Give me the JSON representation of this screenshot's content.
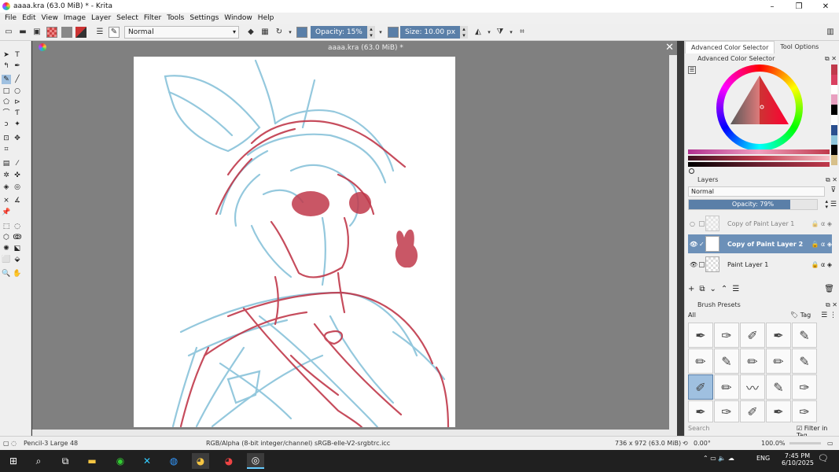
{
  "window": {
    "title": "aaaa.kra (63.0 MiB) * - Krita",
    "minimize": "–",
    "maximize": "❐",
    "close": "✕"
  },
  "menu": [
    "File",
    "Edit",
    "View",
    "Image",
    "Layer",
    "Select",
    "Filter",
    "Tools",
    "Settings",
    "Window",
    "Help"
  ],
  "toolbar": {
    "blend_mode": "Normal",
    "opacity_label": "Opacity: 15%",
    "size_label": "Size: 10.00 px"
  },
  "document": {
    "tab_title": "aaaa.kra (63.0 MiB) *",
    "close": "✕"
  },
  "right_dock": {
    "tabs": [
      "Advanced Color Selector",
      "Tool Options"
    ],
    "color_panel_title": "Advanced Color Selector",
    "layers_title": "Layers",
    "layers_blend": "Normal",
    "layers_opacity": "Opacity:  79%",
    "layers_opacity_value": 0.79,
    "layers": [
      {
        "name": "Copy of Paint Layer 1"
      },
      {
        "name": "Copy of Paint Layer 2"
      },
      {
        "name": "Paint Layer 1"
      }
    ],
    "brush_presets_title": "Brush Presets",
    "brush_filter": "All",
    "tag_label": "Tag",
    "search_placeholder": "Search",
    "filter_in_tag": "Filter in Tag"
  },
  "status": {
    "brush": "Pencil-3 Large 48",
    "color_space": "RGB/Alpha (8-bit integer/channel)  sRGB-elle-V2-srgbtrc.icc",
    "dimensions": "736 x 972 (63.0 MiB)",
    "rotation": "0.00°",
    "zoom": "100.0%"
  },
  "taskbar": {
    "lang": "ENG",
    "time": "7:45 PM",
    "date": "6/10/2025"
  },
  "colors": {
    "accent": "#5a7fa8",
    "sketch_blue": "#8fc6dc",
    "sketch_red": "#c0394b",
    "canvas_bg": "#808080"
  }
}
